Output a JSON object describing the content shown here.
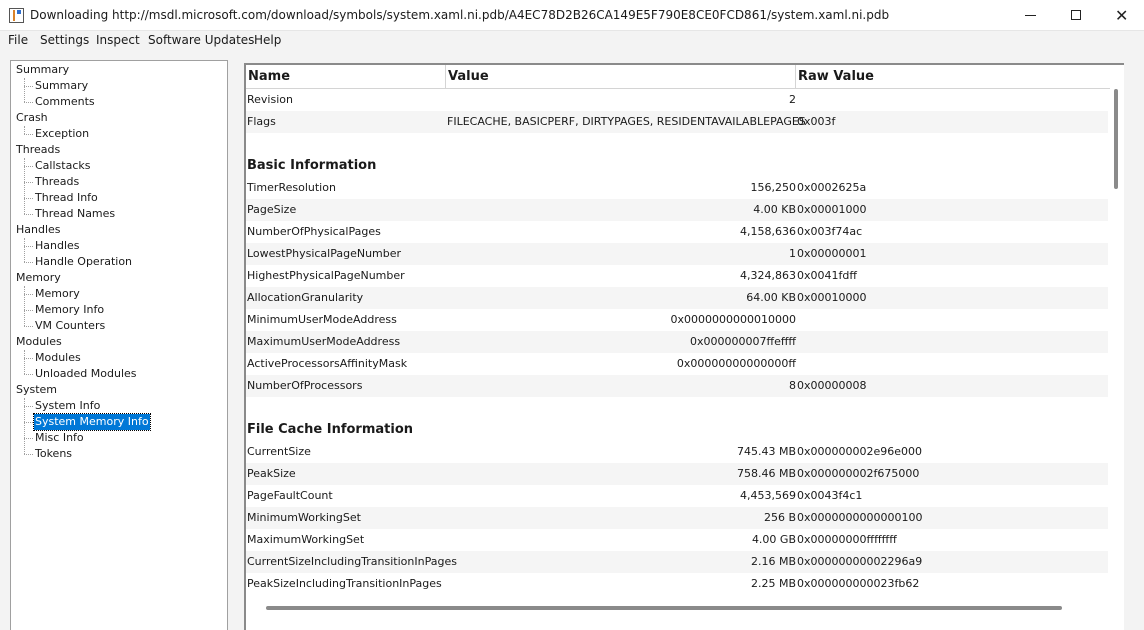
{
  "window": {
    "title": "Downloading http://msdl.microsoft.com/download/symbols/system.xaml.ni.pdb/A4EC78D2B26CA149E5F790E8CE0FCD861/system.xaml.ni.pdb",
    "close_glyph": "✕"
  },
  "menu": [
    "File",
    "Settings",
    "Inspect",
    "Software Updates",
    "Help"
  ],
  "tree": [
    {
      "label": "Summary",
      "children": [
        "Summary",
        "Comments"
      ]
    },
    {
      "label": "Crash",
      "children": [
        "Exception"
      ]
    },
    {
      "label": "Threads",
      "children": [
        "Callstacks",
        "Threads",
        "Thread Info",
        "Thread Names"
      ]
    },
    {
      "label": "Handles",
      "children": [
        "Handles",
        "Handle Operation"
      ]
    },
    {
      "label": "Memory",
      "children": [
        "Memory",
        "Memory Info",
        "VM Counters"
      ]
    },
    {
      "label": "Modules",
      "children": [
        "Modules",
        "Unloaded Modules"
      ]
    },
    {
      "label": "System",
      "children": [
        "System Info",
        "System Memory Info",
        "Misc Info",
        "Tokens"
      ]
    }
  ],
  "tree_selected": "System Memory Info",
  "grid": {
    "columns": {
      "name": "Name",
      "value": "Value",
      "raw": "Raw Value"
    },
    "rows": [
      {
        "name": "Revision",
        "value": "2",
        "raw": ""
      },
      {
        "name": "Flags",
        "value": "FILECACHE, BASICPERF, DIRTYPAGES, RESIDENTAVAILABLEPAGES",
        "raw": "0x003f",
        "align": "left"
      },
      {
        "blank": true
      },
      {
        "section": "Basic Information"
      },
      {
        "name": "TimerResolution",
        "value": "156,250",
        "raw": "0x0002625a"
      },
      {
        "name": "PageSize",
        "value": "4.00 KB",
        "raw": "0x00001000"
      },
      {
        "name": "NumberOfPhysicalPages",
        "value": "4,158,636",
        "raw": "0x003f74ac"
      },
      {
        "name": "LowestPhysicalPageNumber",
        "value": "1",
        "raw": "0x00000001"
      },
      {
        "name": "HighestPhysicalPageNumber",
        "value": "4,324,863",
        "raw": "0x0041fdff"
      },
      {
        "name": "AllocationGranularity",
        "value": "64.00 KB",
        "raw": "0x00010000"
      },
      {
        "name": "MinimumUserModeAddress",
        "value": "0x0000000000010000",
        "raw": ""
      },
      {
        "name": "MaximumUserModeAddress",
        "value": "0x000000007ffeffff",
        "raw": ""
      },
      {
        "name": "ActiveProcessorsAffinityMask",
        "value": "0x00000000000000ff",
        "raw": ""
      },
      {
        "name": "NumberOfProcessors",
        "value": "8",
        "raw": "0x00000008"
      },
      {
        "blank": true
      },
      {
        "section": "File Cache Information"
      },
      {
        "name": "CurrentSize",
        "value": "745.43 MB",
        "raw": "0x000000002e96e000"
      },
      {
        "name": "PeakSize",
        "value": "758.46 MB",
        "raw": "0x000000002f675000"
      },
      {
        "name": "PageFaultCount",
        "value": "4,453,569",
        "raw": "0x0043f4c1"
      },
      {
        "name": "MinimumWorkingSet",
        "value": "256 B",
        "raw": "0x0000000000000100"
      },
      {
        "name": "MaximumWorkingSet",
        "value": "4.00 GB",
        "raw": "0x00000000ffffffff"
      },
      {
        "name": "CurrentSizeIncludingTransitionInPages",
        "value": "2.16 MB",
        "raw": "0x00000000002296a9"
      },
      {
        "name": "PeakSizeIncludingTransitionInPages",
        "value": "2.25 MB",
        "raw": "0x000000000023fb62"
      }
    ]
  }
}
